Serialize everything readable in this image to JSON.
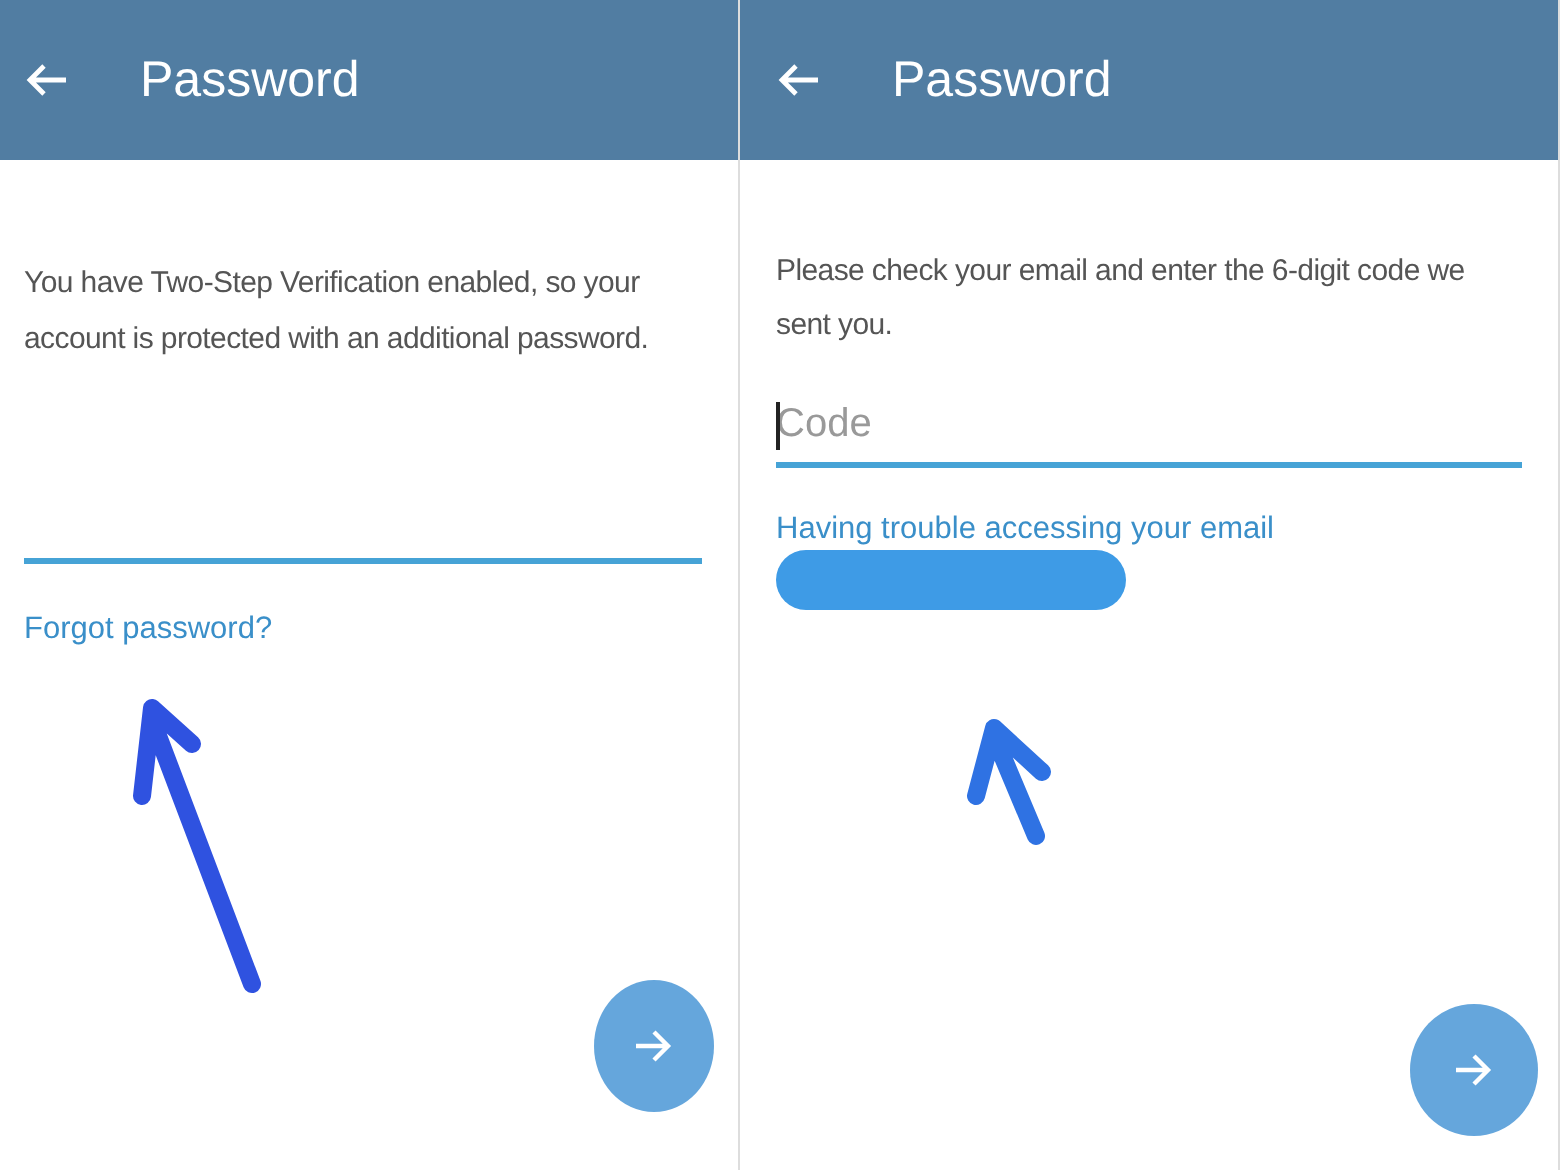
{
  "screens": [
    {
      "title": "Password",
      "message": "You have Two-Step Verification enabled, so your account is protected with an additional password.",
      "field": {
        "focused": false
      },
      "link": "Forgot password?",
      "redacted": false
    },
    {
      "title": "Password",
      "message": "Please check your email and enter the 6-digit code we sent you.",
      "field": {
        "placeholder": "Code",
        "focused": true
      },
      "link": "Having trouble accessing your email",
      "redacted": true
    }
  ]
}
